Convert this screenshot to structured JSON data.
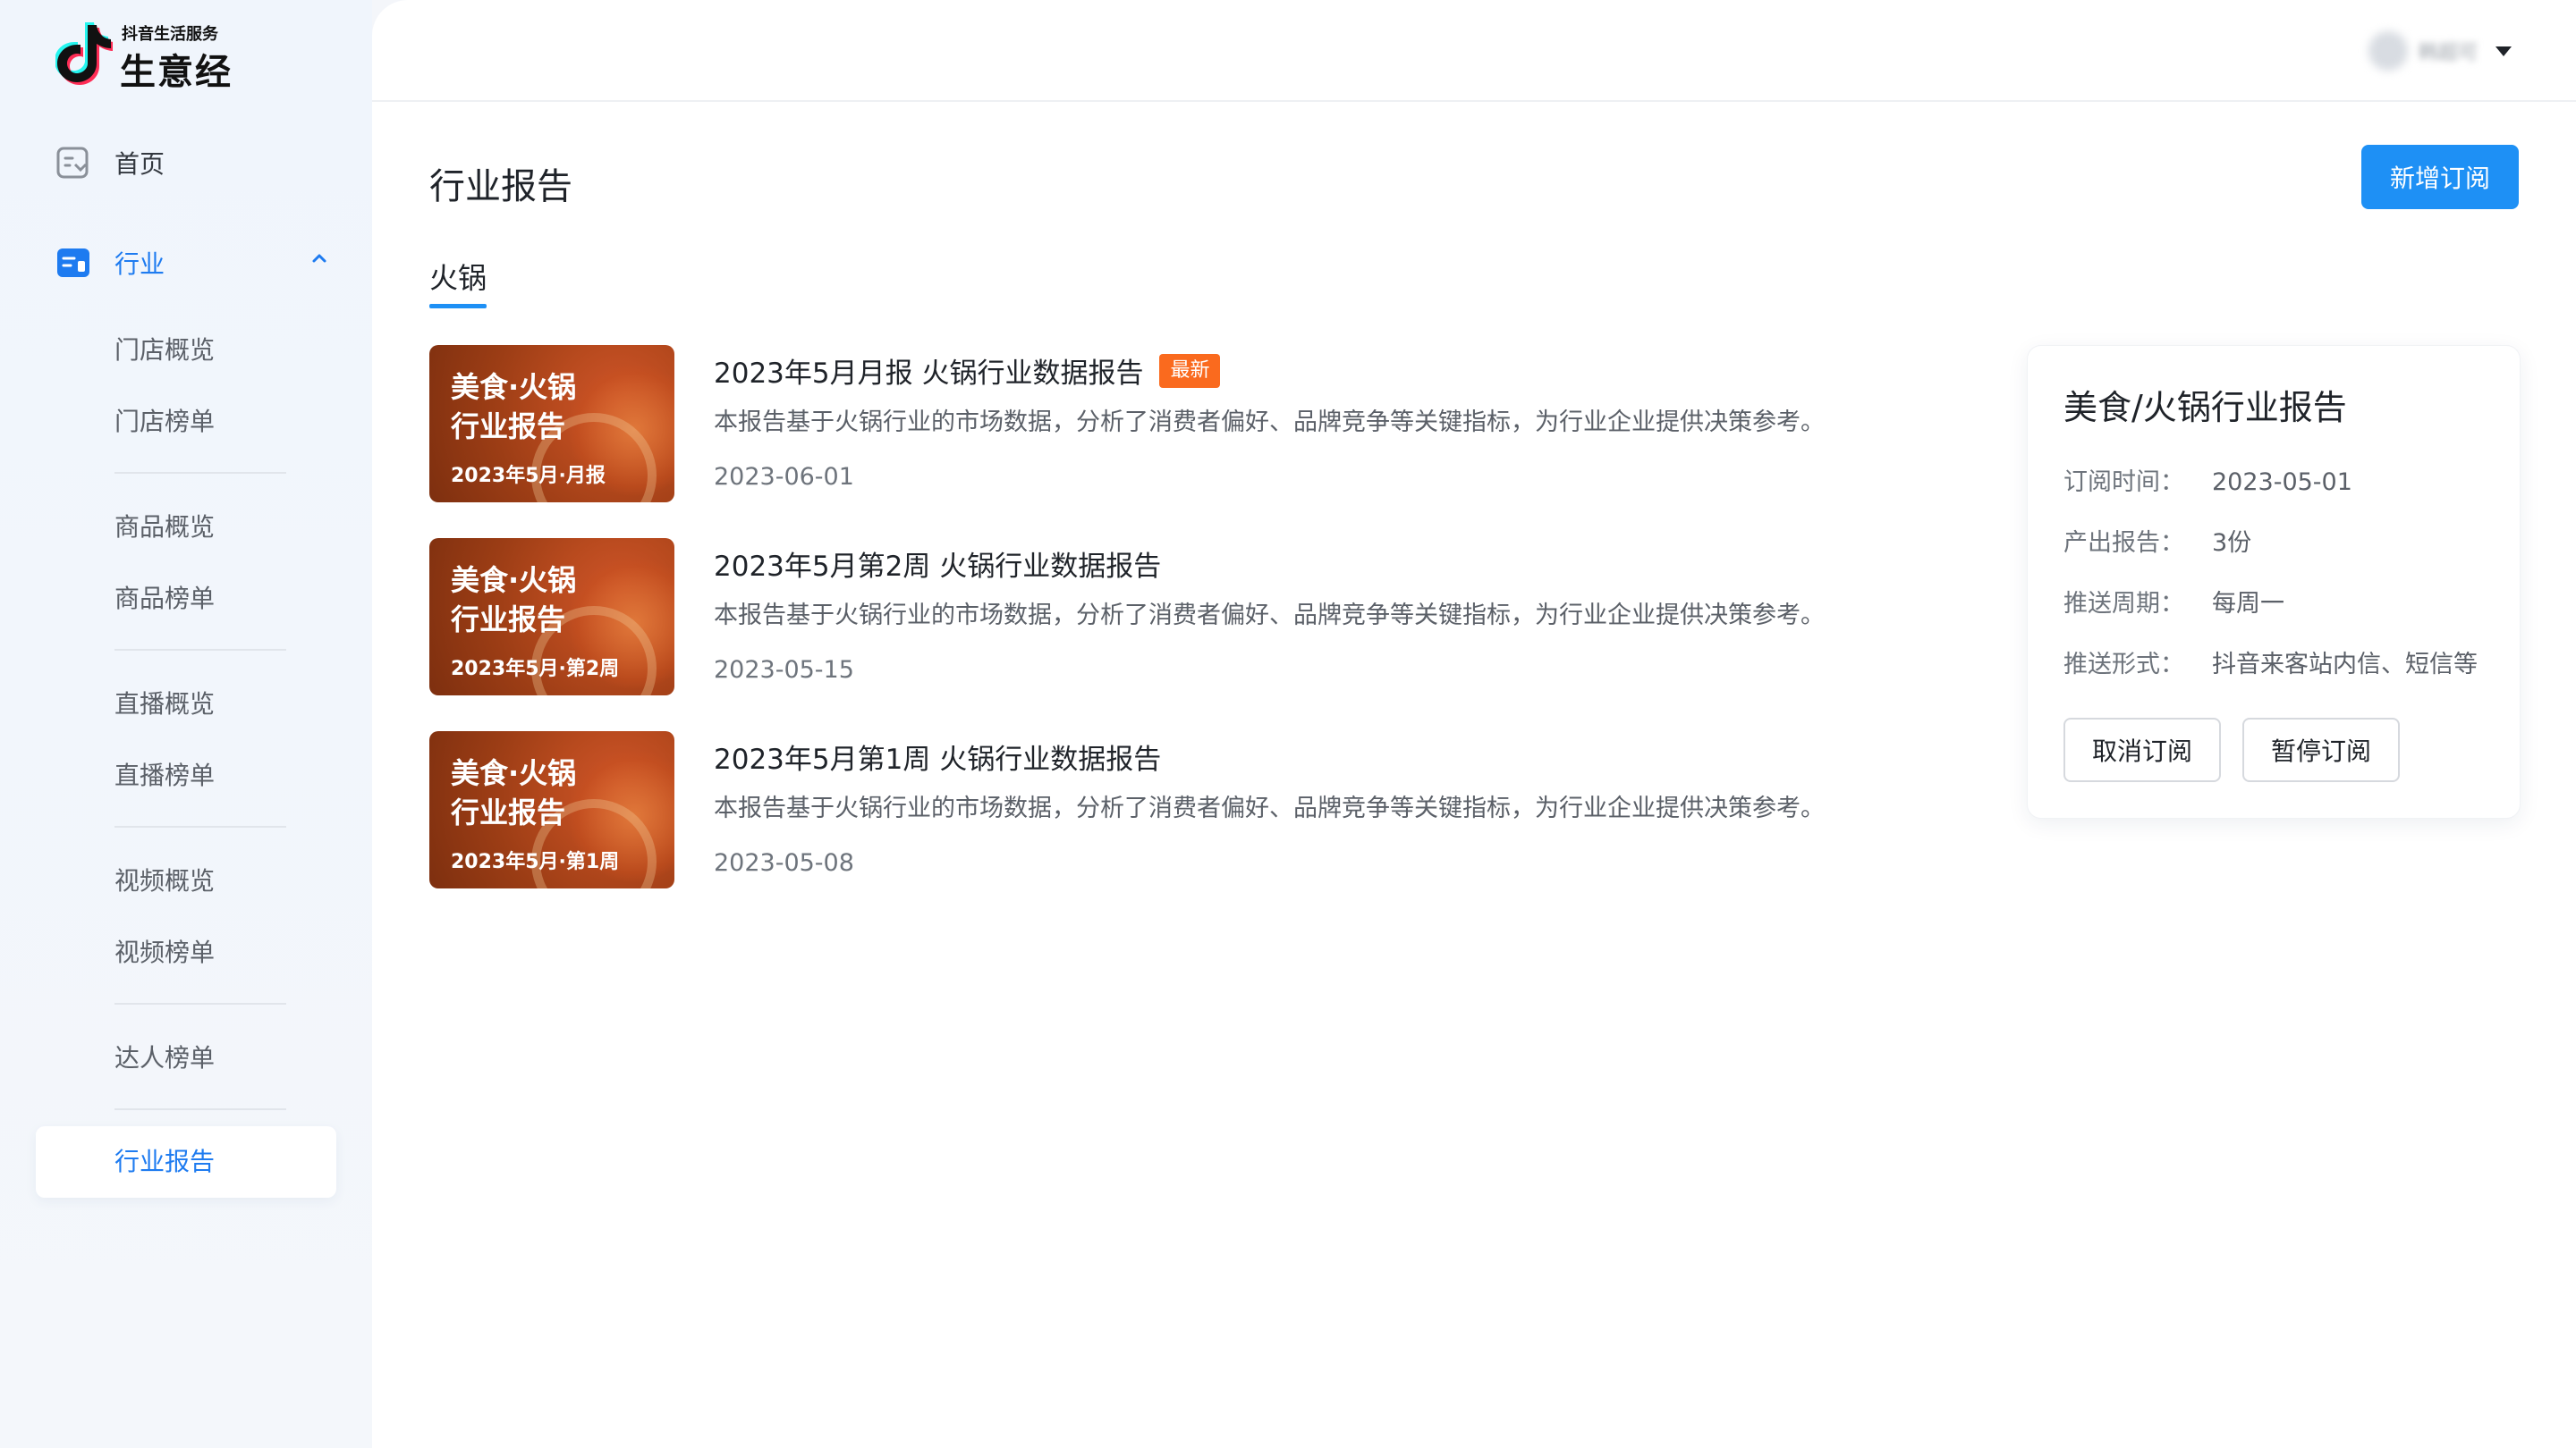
{
  "brand": {
    "subtitle": "抖音生活服务",
    "name": "生意经"
  },
  "sidebar": {
    "home": "首页",
    "industry": "行业",
    "sub_items": [
      "门店概览",
      "门店榜单",
      "商品概览",
      "商品榜单",
      "直播概览",
      "直播榜单",
      "视频概览",
      "视频榜单",
      "达人榜单"
    ],
    "active_item": "行业报告"
  },
  "user": {
    "name": "韩超可"
  },
  "page": {
    "title": "行业报告",
    "new_button": "新增订阅",
    "tab": "火锅"
  },
  "reports": [
    {
      "thumb_line1": "美食·火锅",
      "thumb_line2": "行业报告",
      "thumb_line3": "2023年5月·月报",
      "title": "2023年5月月报 火锅行业数据报告",
      "badge": "最新",
      "desc": "本报告基于火锅行业的市场数据，分析了消费者偏好、品牌竞争等关键指标，为行业企业提供决策参考。",
      "date": "2023-06-01"
    },
    {
      "thumb_line1": "美食·火锅",
      "thumb_line2": "行业报告",
      "thumb_line3": "2023年5月·第2周",
      "title": "2023年5月第2周 火锅行业数据报告",
      "desc": "本报告基于火锅行业的市场数据，分析了消费者偏好、品牌竞争等关键指标，为行业企业提供决策参考。",
      "date": "2023-05-15"
    },
    {
      "thumb_line1": "美食·火锅",
      "thumb_line2": "行业报告",
      "thumb_line3": "2023年5月·第1周",
      "title": "2023年5月第1周 火锅行业数据报告",
      "desc": "本报告基于火锅行业的市场数据，分析了消费者偏好、品牌竞争等关键指标，为行业企业提供决策参考。",
      "date": "2023-05-08"
    }
  ],
  "subscription": {
    "title": "美食/火锅行业报告",
    "rows": [
      {
        "key": "订阅时间：",
        "value": "2023-05-01"
      },
      {
        "key": "产出报告：",
        "value": "3份"
      },
      {
        "key": "推送周期：",
        "value": "每周一"
      },
      {
        "key": "推送形式：",
        "value": "抖音来客站内信、短信等"
      }
    ],
    "cancel_button": "取消订阅",
    "pause_button": "暂停订阅"
  },
  "colors": {
    "accent": "#1e90f5",
    "badge": "#fa6a1e",
    "active_nav": "#1e7bf0"
  }
}
